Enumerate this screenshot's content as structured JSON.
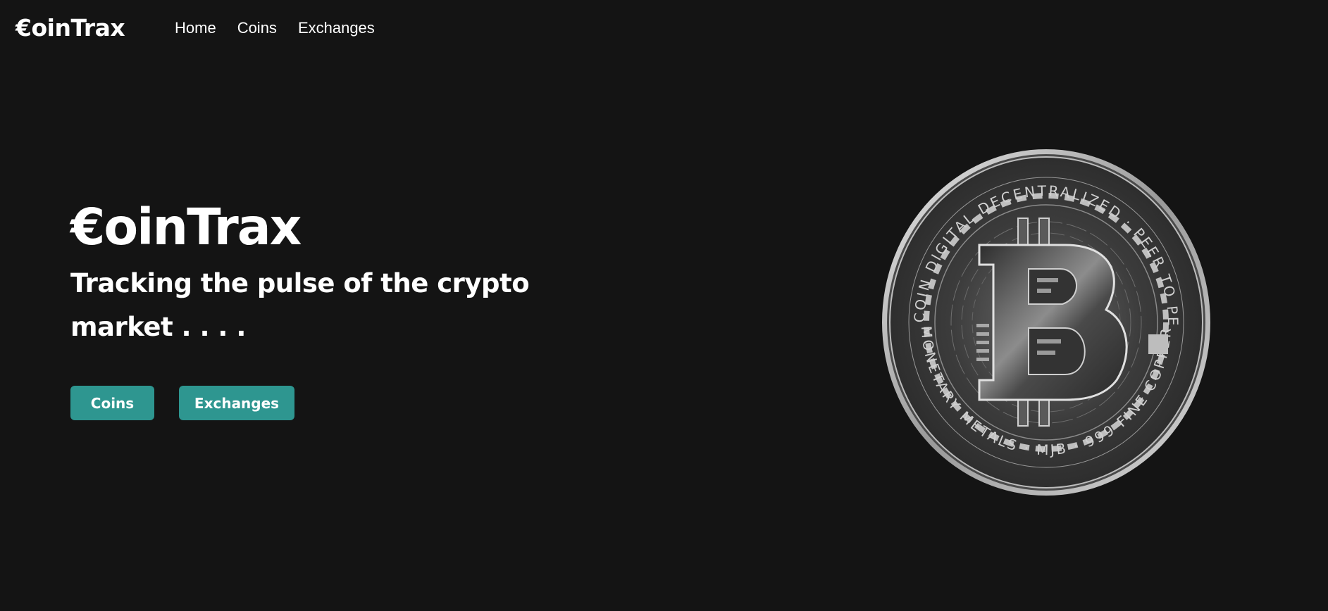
{
  "nav": {
    "brand": "€oinTrax",
    "links": [
      "Home",
      "Coins",
      "Exchanges"
    ]
  },
  "hero": {
    "title": "€oinTrax",
    "subtitle": "Tracking the pulse of the crypto market . . . .",
    "buttons": [
      "Coins",
      "Exchanges"
    ]
  },
  "coin": {
    "top_text": "BITCOIN DIGITAL DECENTRALIZED · PEER TO PEER",
    "bottom_text": "MONETARY METALS · MJB · 999 FINE COPPER",
    "symbol": "B"
  },
  "colors": {
    "background": "#141414",
    "accent": "#2e9690",
    "text": "#ffffff"
  }
}
